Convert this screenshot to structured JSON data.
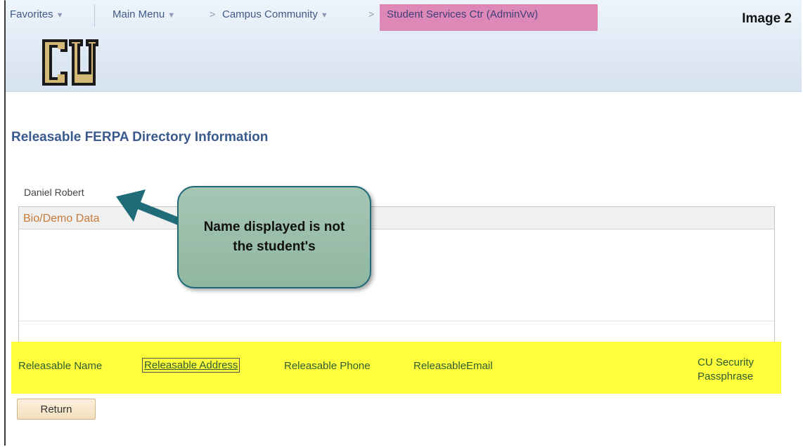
{
  "nav": {
    "favorites": "Favorites",
    "main_menu": "Main Menu",
    "campus_community": "Campus Community",
    "current": "Student Services Ctr (AdminVw)",
    "separator": ">"
  },
  "image_label": "Image 2",
  "logo_text": "CU",
  "page_title": "Releasable FERPA Directory Information",
  "student_name": "Daniel Robert",
  "grid": {
    "header": "Bio/Demo Data"
  },
  "tabs": [
    {
      "label": "Releasable Name",
      "selected": false
    },
    {
      "label": "Releasable Address",
      "selected": true
    },
    {
      "label": "Releasable Phone",
      "selected": false
    },
    {
      "label": "ReleasableEmail",
      "selected": false
    },
    {
      "label": "CU Security Passphrase",
      "selected": false
    }
  ],
  "return_button": "Return",
  "callout": {
    "text": "Name displayed is not the student's"
  },
  "colors": {
    "highlight": "#fefe3c",
    "nav_current": "#dd88b6",
    "callout_fill": "#9bbfab",
    "callout_border": "#1f6b78",
    "title": "#3a5a8c"
  },
  "icons": {
    "nav_caret": "chevron-down-icon",
    "callout_arrow": "arrow-icon"
  }
}
